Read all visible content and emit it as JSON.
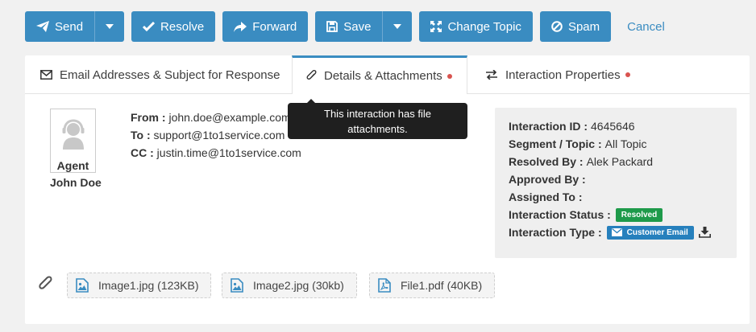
{
  "toolbar": {
    "send_label": "Send",
    "resolve_label": "Resolve",
    "forward_label": "Forward",
    "save_label": "Save",
    "change_topic_label": "Change Topic",
    "spam_label": "Spam",
    "cancel_label": "Cancel"
  },
  "tabs": [
    {
      "label": "Email Addresses & Subject for Response",
      "icon": "envelope-icon",
      "active": false,
      "dot": false
    },
    {
      "label": "Details & Attachments",
      "icon": "paperclip-icon",
      "active": true,
      "dot": true
    },
    {
      "label": "Interaction Properties",
      "icon": "exchange-icon",
      "active": false,
      "dot": true
    }
  ],
  "tooltip": {
    "line1": "This interaction has file",
    "line2": "attachments."
  },
  "agent": {
    "role": "Agent",
    "name": "John Doe"
  },
  "email": {
    "from_label": "From :",
    "from": "john.doe@example.com",
    "to_label": "To :",
    "to": "support@1to1service.com",
    "cc_label": "CC :",
    "cc": "justin.time@1to1service.com"
  },
  "properties": {
    "interaction_id_label": "Interaction ID :",
    "interaction_id": "4645646",
    "segment_label": "Segment / Topic :",
    "segment": "All Topic",
    "resolved_by_label": "Resolved By :",
    "resolved_by": "Alek Packard",
    "approved_by_label": "Approved By :",
    "approved_by": "",
    "assigned_to_label": "Assigned To :",
    "assigned_to": "",
    "status_label": "Interaction Status :",
    "status": "Resolved",
    "type_label": "Interaction Type :",
    "type": "Customer Email"
  },
  "attachments": [
    {
      "name": "Image1.jpg (123KB)",
      "icon": "image-file-icon"
    },
    {
      "name": "Image2.jpg (30kb)",
      "icon": "image-file-icon"
    },
    {
      "name": "File1.pdf (40KB)",
      "icon": "pdf-file-icon"
    }
  ],
  "colors": {
    "accent": "#3a8cc1",
    "resolved": "#1e9a4a",
    "email_badge": "#2680bd",
    "dot": "#d9534f"
  }
}
